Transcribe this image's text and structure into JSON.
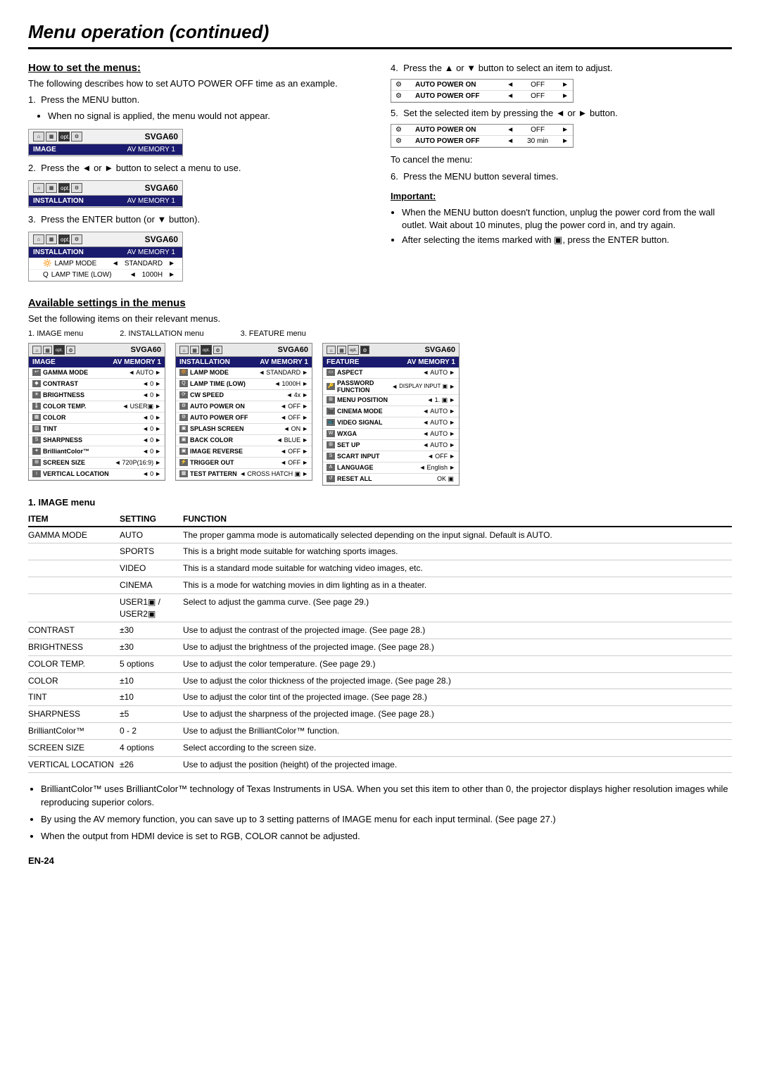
{
  "page": {
    "title": "Menu operation (continued)",
    "page_number": "EN-24"
  },
  "how_to_set": {
    "heading": "How to set the menus:",
    "intro": "The following describes how to set AUTO POWER OFF time as an example.",
    "steps": [
      {
        "num": "1.",
        "text": "Press the MENU button.",
        "sub_bullets": [
          "When no signal is applied, the menu would not appear."
        ]
      },
      {
        "num": "2.",
        "text": "Press the ◄ or ► button to select a menu to use."
      },
      {
        "num": "3.",
        "text": "Press the ENTER button (or ▼ button)."
      }
    ],
    "step4_text": "4.  Press the ▲ or ▼ button to select an item to adjust.",
    "step5_text": "5.  Set the selected item by pressing the ◄ or ► button.",
    "cancel_label": "To cancel the menu:",
    "cancel_text": "6.  Press the MENU button several times.",
    "important_label": "Important:",
    "important_bullets": [
      "When the MENU button doesn't function, unplug the power cord from the wall outlet. Wait about 10 minutes, plug the power cord in, and try again.",
      "After selecting the items marked with ▣, press the ENTER button."
    ]
  },
  "panel1": {
    "model": "SVGA60",
    "row1_label": "IMAGE",
    "row1_value": "AV MEMORY 1"
  },
  "panel2": {
    "model": "SVGA60",
    "row1_label": "INSTALLATION",
    "row1_value": "AV MEMORY 1"
  },
  "panel3": {
    "model": "SVGA60",
    "row1_label": "INSTALLATION",
    "row1_value": "AV MEMORY 1",
    "subrows": [
      {
        "icon": "🔆",
        "label": "LAMP MODE",
        "arrow_l": "◄",
        "value": "STANDARD",
        "arrow_r": "►"
      },
      {
        "icon": "Q",
        "label": "LAMP TIME (LOW)",
        "arrow_l": "◄",
        "value": "1000H",
        "arrow_r": "►"
      }
    ]
  },
  "mini_panels": {
    "step4": [
      {
        "icon": "⚙",
        "label": "AUTO POWER ON",
        "arrow_l": "◄",
        "value": "OFF",
        "arrow_r": "►"
      },
      {
        "icon": "⚙",
        "label": "AUTO POWER OFF",
        "arrow_l": "◄",
        "value": "OFF",
        "arrow_r": "►"
      }
    ],
    "step5": [
      {
        "icon": "⚙",
        "label": "AUTO POWER ON",
        "arrow_l": "◄",
        "value": "OFF",
        "arrow_r": "►"
      },
      {
        "icon": "⚙",
        "label": "AUTO POWER OFF",
        "arrow_l": "◄",
        "value": "30 min",
        "arrow_r": "►"
      }
    ]
  },
  "available_settings": {
    "heading": "Available settings in the menus",
    "intro": "Set the following items on their relevant menus.",
    "menu1_caption": "1. IMAGE menu",
    "menu2_caption": "2. INSTALLATION menu",
    "menu3_caption": "3. FEATURE menu",
    "image_menu": {
      "model": "SVGA60",
      "header_left": "IMAGE",
      "header_right": "AV MEMORY 1",
      "rows": [
        {
          "icon": "↩",
          "label": "GAMMA MODE",
          "arrow_l": "◄",
          "value": "AUTO",
          "arrow_r": "►"
        },
        {
          "icon": "◆",
          "label": "CONTRAST",
          "arrow_l": "◄",
          "value": "0",
          "arrow_r": "►"
        },
        {
          "icon": "☀",
          "label": "BRIGHTNESS",
          "arrow_l": "◄",
          "value": "0",
          "arrow_r": "►"
        },
        {
          "icon": "🌡",
          "label": "COLOR TEMP.",
          "arrow_l": "◄",
          "value": "USER▣",
          "arrow_r": "►"
        },
        {
          "icon": "▦",
          "label": "COLOR",
          "arrow_l": "◄",
          "value": "0",
          "arrow_r": "►"
        },
        {
          "icon": "▨",
          "label": "TINT",
          "arrow_l": "◄",
          "value": "0",
          "arrow_r": "►"
        },
        {
          "icon": "S",
          "label": "SHARPNESS",
          "arrow_l": "◄",
          "value": "0",
          "arrow_r": "►"
        },
        {
          "icon": "✦",
          "label": "BrilliantColor™",
          "arrow_l": "◄",
          "value": "0",
          "arrow_r": "►"
        },
        {
          "icon": "⊞",
          "label": "SCREEN SIZE",
          "arrow_l": "◄",
          "value": "720P(16:9)",
          "arrow_r": "►"
        },
        {
          "icon": "↕",
          "label": "VERTICAL LOCATION",
          "arrow_l": "◄",
          "value": "0",
          "arrow_r": "►"
        }
      ]
    },
    "installation_menu": {
      "model": "SVGA60",
      "header_left": "INSTALLATION",
      "header_right": "AV MEMORY 1",
      "rows": [
        {
          "icon": "🔆",
          "label": "LAMP MODE",
          "arrow_l": "◄",
          "value": "STANDARD",
          "arrow_r": "►"
        },
        {
          "icon": "Q",
          "label": "LAMP TIME (LOW)",
          "arrow_l": "◄",
          "value": "1000H",
          "arrow_r": "►"
        },
        {
          "icon": "⟳",
          "label": "CW SPEED",
          "arrow_l": "◄",
          "value": "4x",
          "arrow_r": "►"
        },
        {
          "icon": "⚙",
          "label": "AUTO POWER ON",
          "arrow_l": "◄",
          "value": "OFF",
          "arrow_r": "►"
        },
        {
          "icon": "⚙",
          "label": "AUTO POWER OFF",
          "arrow_l": "◄",
          "value": "OFF",
          "arrow_r": "►"
        },
        {
          "icon": "▣",
          "label": "SPLASH SCREEN",
          "arrow_l": "◄",
          "value": "ON",
          "arrow_r": "►"
        },
        {
          "icon": "▣",
          "label": "BACK COLOR",
          "arrow_l": "◄",
          "value": "BLUE",
          "arrow_r": "►"
        },
        {
          "icon": "▣",
          "label": "IMAGE REVERSE",
          "arrow_l": "◄",
          "value": "OFF",
          "arrow_r": "►"
        },
        {
          "icon": "⚡",
          "label": "TRIGGER OUT",
          "arrow_l": "◄",
          "value": "OFF",
          "arrow_r": "►"
        },
        {
          "icon": "▦",
          "label": "TEST PATTERN",
          "arrow_l": "◄",
          "value": "CROSS HATCH ▣",
          "arrow_r": "►"
        }
      ]
    },
    "feature_menu": {
      "model": "SVGA60",
      "header_left": "FEATURE",
      "header_right": "AV MEMORY 1",
      "rows": [
        {
          "icon": "▭",
          "label": "ASPECT",
          "arrow_l": "◄",
          "value": "AUTO",
          "arrow_r": "►"
        },
        {
          "icon": "🔑",
          "label": "PASSWORD FUNCTION",
          "arrow_l": "◄",
          "value": "DISPLAY INPUT ▣",
          "arrow_r": "►"
        },
        {
          "icon": "⊞",
          "label": "MENU POSITION",
          "arrow_l": "◄",
          "value": "1. ▣",
          "arrow_r": "►"
        },
        {
          "icon": "🎬",
          "label": "CINEMA MODE",
          "arrow_l": "◄",
          "value": "AUTO",
          "arrow_r": "►"
        },
        {
          "icon": "📺",
          "label": "VIDEO SIGNAL",
          "arrow_l": "◄",
          "value": "AUTO",
          "arrow_r": "►"
        },
        {
          "icon": "W",
          "label": "WXGA",
          "arrow_l": "◄",
          "value": "AUTO",
          "arrow_r": "►"
        },
        {
          "icon": "⊞",
          "label": "SET UP",
          "arrow_l": "◄",
          "value": "AUTO",
          "arrow_r": "►"
        },
        {
          "icon": "S",
          "label": "SCART INPUT",
          "arrow_l": "◄",
          "value": "OFF",
          "arrow_r": "►"
        },
        {
          "icon": "A",
          "label": "LANGUAGE",
          "arrow_l": "◄",
          "value": "English",
          "arrow_r": "►"
        },
        {
          "icon": "↺",
          "label": "RESET ALL",
          "arrow_l": "",
          "value": "OK ▣",
          "arrow_r": ""
        }
      ]
    }
  },
  "image_menu_table": {
    "heading": "1. IMAGE menu",
    "col_item": "ITEM",
    "col_setting": "SETTING",
    "col_function": "FUNCTION",
    "rows": [
      {
        "item": "GAMMA MODE",
        "setting": "AUTO",
        "function": "The proper gamma mode is automatically selected depending on the input signal. Default is AUTO."
      },
      {
        "item": "",
        "setting": "SPORTS",
        "function": "This is a bright mode suitable for watching sports images."
      },
      {
        "item": "",
        "setting": "VIDEO",
        "function": "This is a standard mode suitable for watching video images, etc."
      },
      {
        "item": "",
        "setting": "CINEMA",
        "function": "This is a mode for watching movies in dim lighting as in a theater."
      },
      {
        "item": "",
        "setting": "USER1▣ / USER2▣",
        "function": "Select to adjust the gamma curve. (See page 29.)"
      },
      {
        "item": "CONTRAST",
        "setting": "±30",
        "function": "Use to adjust the contrast of the projected image. (See page 28.)"
      },
      {
        "item": "BRIGHTNESS",
        "setting": "±30",
        "function": "Use to adjust the brightness of the projected image. (See page 28.)"
      },
      {
        "item": "COLOR TEMP.",
        "setting": "5 options",
        "function": "Use to adjust the color temperature. (See page 29.)"
      },
      {
        "item": "COLOR",
        "setting": "±10",
        "function": "Use to adjust the color thickness of the projected image. (See page 28.)"
      },
      {
        "item": "TINT",
        "setting": "±10",
        "function": "Use to adjust the color tint of the projected image. (See page 28.)"
      },
      {
        "item": "SHARPNESS",
        "setting": "±5",
        "function": "Use to adjust the sharpness of the projected image. (See page 28.)"
      },
      {
        "item": "BrilliantColor™",
        "setting": "0 - 2",
        "function": "Use to adjust the BrilliantColor™ function."
      },
      {
        "item": "SCREEN SIZE",
        "setting": "4 options",
        "function": "Select according to the screen size."
      },
      {
        "item": "VERTICAL LOCATION",
        "setting": "±26",
        "function": "Use to adjust the position (height) of the projected image."
      }
    ]
  },
  "bottom_notes": [
    "BrilliantColor™ uses BrilliantColor™ technology of Texas Instruments in USA. When you set this item to other than 0, the projector displays higher resolution images while reproducing superior colors.",
    "By using the AV memory function, you can save up to 3 setting patterns of IMAGE menu for each input terminal. (See page 27.)",
    "When the output from HDMI device is set to RGB, COLOR cannot be adjusted."
  ]
}
